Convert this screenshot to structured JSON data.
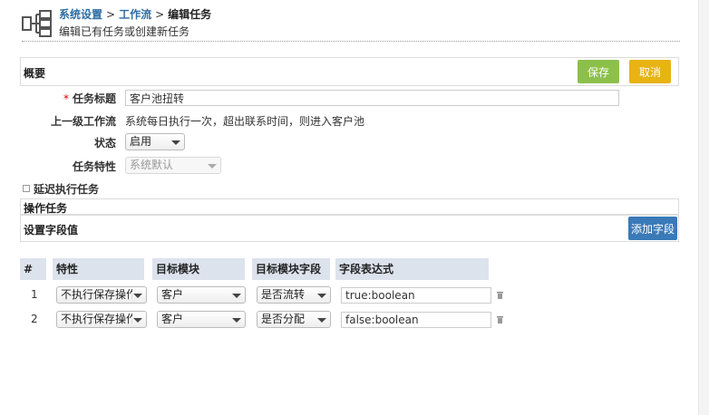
{
  "breadcrumb": {
    "item1": "系统设置",
    "item2": "工作流",
    "current": "编辑任务",
    "separator": ">"
  },
  "subtitle": "编辑已有任务或创建新任务",
  "summary": {
    "title": "概要",
    "save_label": "保存",
    "cancel_label": "取消"
  },
  "form": {
    "task_title_label": "任务标题",
    "task_title_value": "客户池扭转",
    "parent_label": "上一级工作流",
    "parent_value": "系统每日执行一次，超出联系时间，则进入客户池",
    "status_label": "状态",
    "status_value": "启用",
    "feature_label": "任务特性",
    "feature_value": "系统默认",
    "delay_label": "延迟执行任务"
  },
  "operation_panel": {
    "title": "操作任务"
  },
  "field_panel": {
    "title": "设置字段值",
    "add_label": "添加字段"
  },
  "table": {
    "headers": [
      "#",
      "特性",
      "目标模块",
      "目标模块字段",
      "字段表达式"
    ],
    "rows": [
      {
        "num": "1",
        "feature": "不执行保存操作",
        "module": "客户",
        "field": "是否流转",
        "expr": "true:boolean"
      },
      {
        "num": "2",
        "feature": "不执行保存操作",
        "module": "客户",
        "field": "是否分配",
        "expr": "false:boolean"
      }
    ]
  },
  "icons": {
    "header": "workflow-icon",
    "delete": "trash-icon"
  },
  "colors": {
    "save": "#8cc04a",
    "cancel": "#e8b313",
    "add": "#3a7ab8",
    "link": "#2e6da4",
    "table_header": "#dde3ed"
  }
}
